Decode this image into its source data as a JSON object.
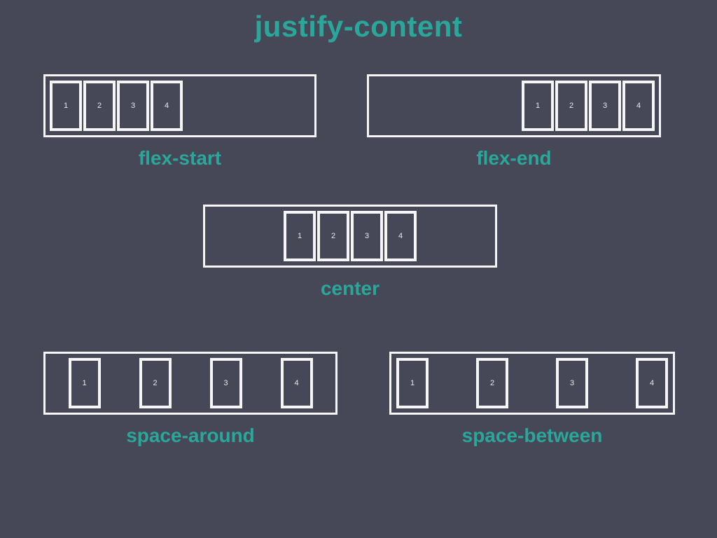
{
  "title": "justify-content",
  "items": [
    "1",
    "2",
    "3",
    "4"
  ],
  "examples": {
    "flex_start": {
      "label": "flex-start"
    },
    "flex_end": {
      "label": "flex-end"
    },
    "center": {
      "label": "center"
    },
    "space_around": {
      "label": "space-around"
    },
    "space_between": {
      "label": "space-between"
    }
  }
}
